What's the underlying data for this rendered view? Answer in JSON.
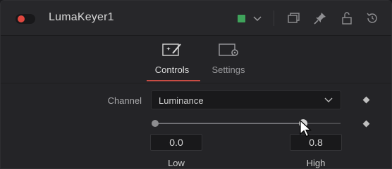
{
  "header": {
    "title": "LumaKeyer1",
    "enabled": true,
    "color_swatch": "#3fa35b",
    "icons": [
      "chevron-down-icon",
      "versions-icon",
      "pin-icon",
      "lock-icon",
      "reset-icon"
    ]
  },
  "tabs": [
    {
      "label": "Controls",
      "active": true,
      "icon": "controls-icon"
    },
    {
      "label": "Settings",
      "active": false,
      "icon": "settings-icon"
    }
  ],
  "controls": {
    "channel_label": "Channel",
    "channel_value": "Luminance",
    "range": {
      "low": 0.0,
      "high": 0.8,
      "min": 0.0,
      "max": 1.0
    },
    "low_value": "0.0",
    "high_value": "0.8",
    "low_label": "Low",
    "high_label": "High"
  },
  "colors": {
    "accent_red": "#e0473f",
    "tab_underline": "#c84c44",
    "panel_bg": "#242427"
  }
}
